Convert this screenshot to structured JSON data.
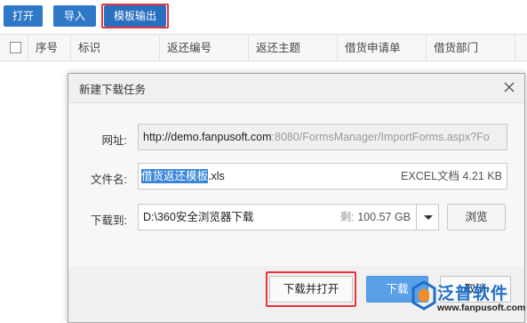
{
  "toolbar": {
    "open_label": "打开",
    "import_label": "导入",
    "export_label": "模板输出"
  },
  "table": {
    "headers": [
      "序号",
      "标识",
      "返还编号",
      "返还主题",
      "借货申请单",
      "借货部门"
    ]
  },
  "dialog": {
    "title": "新建下载任务",
    "url_label": "网址:",
    "url_host": "http://demo.fanpusoft.com",
    "url_rest": ":8080/FormsManager/ImportForms.aspx?Fo",
    "file_label": "文件名:",
    "file_name_selected": "借货返还模板",
    "file_ext": ".xls",
    "file_type_size": "EXCEL文档 4.21 KB",
    "dest_label": "下载到:",
    "dest_path": "D:\\360安全浏览器下载",
    "free_label": "剩:",
    "free_space": "100.57 GB",
    "browse_label": "浏览",
    "open_after_label": "下载并打开",
    "download_label": "下载",
    "cancel_label": "取消"
  },
  "watermark": {
    "brand": "泛普软件",
    "url": "www.fanpusoft.com"
  },
  "colors": {
    "toolbar_blue": "#2f78c8",
    "highlight_red": "#e8343c",
    "download_blue": "#5aa0e8",
    "brand_blue": "#1e6fc8"
  }
}
